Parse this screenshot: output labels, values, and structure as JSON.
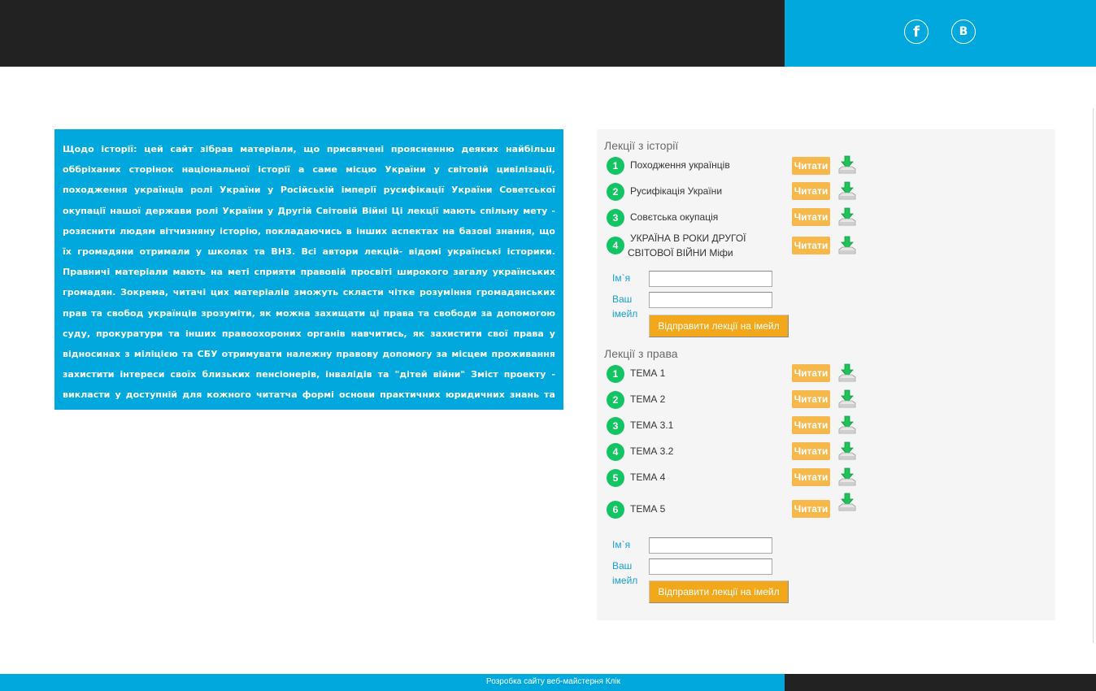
{
  "header": {
    "social": [
      {
        "icon": "facebook-icon",
        "glyph": "f"
      },
      {
        "icon": "vk-icon",
        "glyph": "B"
      }
    ]
  },
  "intro": {
    "text": "Щодо історії: цей сайт зібрав матеріали, що присвячені проясненню деяких найбільш оббріханих сторінок національної історії а саме місцю України у світовій цивілізації, походження українців ролі України у Російській імперії русифікації України Советської окупації нашої держави ролі України у Другій Світовій Війні Ці лекції мають спільну мету - розяснити людям вітчизняну історію, покладаючись в інших аспектах на базові знання, що їх громадяни отримали у школах та ВНЗ. Всі автори лекцій- відомі українські історики. Правничі матеріали мають на меті сприяти правовій просвіті широкого загалу українських громадян. Зокрема, читачі цих матеріалів зможуть скласти чітке розуміння громадянських прав та свобод українців зрозуміти, як можна захищати ці права та свободи за допомогою суду, прокуратури та інших правоохороних органів навчитись, як захистити свої права у відносинах з міліцією та СБУ отримувати належну правову допомогу за місцем проживання захистити інтереси своїх близьких пенсіонерів, інвалідів та \"дітей війни\" Зміст проекту - викласти у доступній для кожного читатча формі основи практичних юридичних знань та дати практичні поради із захисту своїх прав."
  },
  "history": {
    "title": "Лекції з історії",
    "lectures": [
      {
        "num": "1",
        "title": "Походження українців",
        "button": "Читати"
      },
      {
        "num": "2",
        "title": "Русифікація України",
        "button": "Читати"
      },
      {
        "num": "3",
        "title": "Совєтська окупація",
        "button": "Читати"
      },
      {
        "num": "4",
        "title_line1": "УКРАЇНА В РОКИ ДРУГОЇ",
        "title_line2": "СВІТОВОЇ ВІЙНИ Міфи",
        "button": "Читати"
      }
    ],
    "form": {
      "name_label": "Ім`я",
      "email_label_line1": "Ваш",
      "email_label_line2": "імейл",
      "name_value": "",
      "email_value": "",
      "submit": "Відправити лекції на імейл"
    }
  },
  "law": {
    "title": "Лекції з права",
    "lectures": [
      {
        "num": "1",
        "title": "ТЕМА 1",
        "button": "Читати"
      },
      {
        "num": "2",
        "title": "ТЕМА 2",
        "button": "Читати"
      },
      {
        "num": "3",
        "title": "ТЕМА 3.1",
        "button": "Читати"
      },
      {
        "num": "4",
        "title": "ТЕМА 3.2",
        "button": "Читати"
      },
      {
        "num": "5",
        "title": "ТЕМА 4",
        "button": "Читати"
      },
      {
        "num": "6",
        "title": "ТЕМА 5",
        "button": "Читати"
      }
    ],
    "form": {
      "name_label": "Ім`я",
      "email_label_line1": "Ваш",
      "email_label_line2": "імейл",
      "name_value": "",
      "email_value": "",
      "submit": "Відправити лекції на імейл"
    }
  },
  "footer": {
    "credit": "Розробка сайту веб-майстерня Клік"
  },
  "colors": {
    "brand_blue": "#00a8dd",
    "dark": "#222222",
    "number_green": "#12c464",
    "read_orange": "#f7b84b",
    "send_orange": "#f3a81b"
  }
}
